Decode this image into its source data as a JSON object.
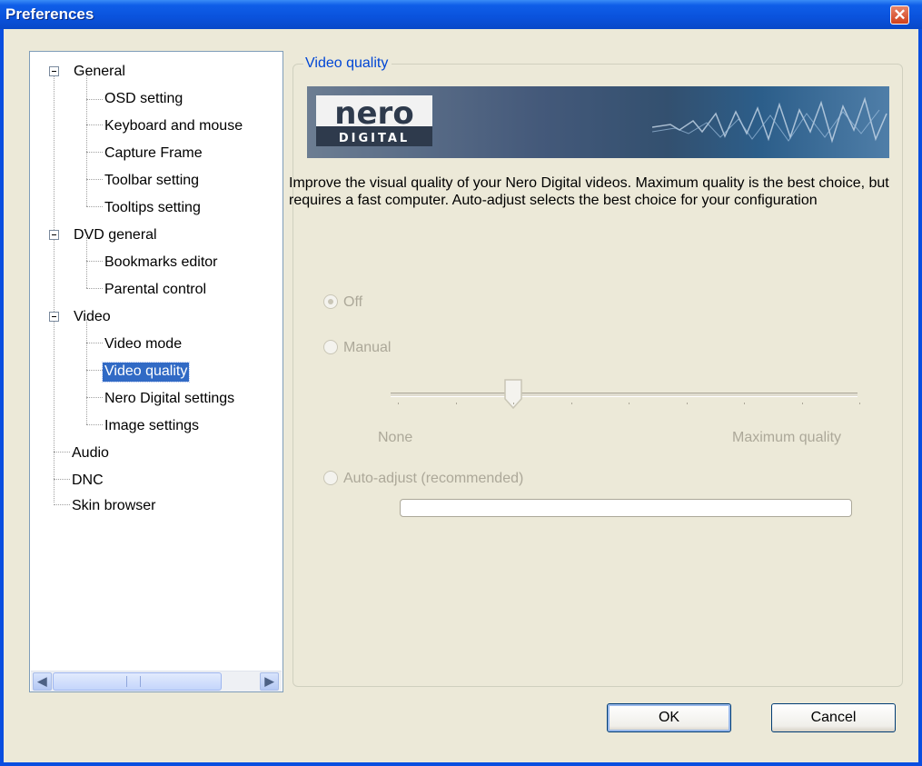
{
  "window": {
    "title": "Preferences"
  },
  "tree": {
    "items": [
      {
        "label": "General"
      },
      {
        "label": "OSD setting"
      },
      {
        "label": "Keyboard and mouse"
      },
      {
        "label": "Capture Frame"
      },
      {
        "label": "Toolbar setting"
      },
      {
        "label": "Tooltips setting"
      },
      {
        "label": "DVD general"
      },
      {
        "label": "Bookmarks editor"
      },
      {
        "label": "Parental control"
      },
      {
        "label": "Video"
      },
      {
        "label": "Video mode"
      },
      {
        "label": "Video quality"
      },
      {
        "label": "Nero Digital settings"
      },
      {
        "label": "Image settings"
      },
      {
        "label": "Audio"
      },
      {
        "label": "DNC"
      },
      {
        "label": "Skin browser"
      }
    ],
    "selected": "Video quality"
  },
  "panel": {
    "group_title": "Video quality",
    "banner": {
      "logo_top": "nero",
      "logo_bottom": "DIGITAL"
    },
    "description": "Improve the visual quality of your Nero Digital videos. Maximum quality is the best choice, but requires a fast computer. Auto-adjust selects the best choice for your configuration",
    "options": {
      "off": "Off",
      "manual": "Manual",
      "auto": "Auto-adjust (recommended)"
    },
    "selected_option": "Off",
    "slider": {
      "min_label": "None",
      "max_label": "Maximum quality",
      "position_fraction": 0.25,
      "tick_count": 9
    },
    "progress_fraction": 0
  },
  "buttons": {
    "ok": "OK",
    "cancel": "Cancel"
  },
  "colors": {
    "titlebar": "#0a52dc",
    "selection": "#316ac5",
    "group_label": "#0046d5",
    "disabled_text": "#aca899"
  },
  "icons": {
    "close": "close-icon",
    "scroll_left": "arrow-left-icon",
    "scroll_right": "arrow-right-icon"
  }
}
